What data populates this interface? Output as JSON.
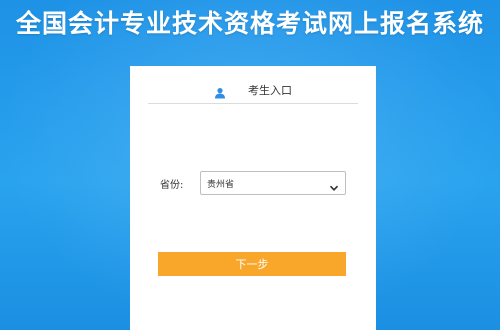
{
  "site": {
    "title": "全国会计专业技术资格考试网上报名系统"
  },
  "panel": {
    "title": "考生入口",
    "user_icon": "user-icon",
    "province_label": "省份:",
    "province_value": "贵州省",
    "dropdown_icon": "chevron-down-icon",
    "next_label": "下一步"
  },
  "colors": {
    "background": "#1e92e6",
    "button": "#f8a72b",
    "icon": "#2f8de4"
  }
}
